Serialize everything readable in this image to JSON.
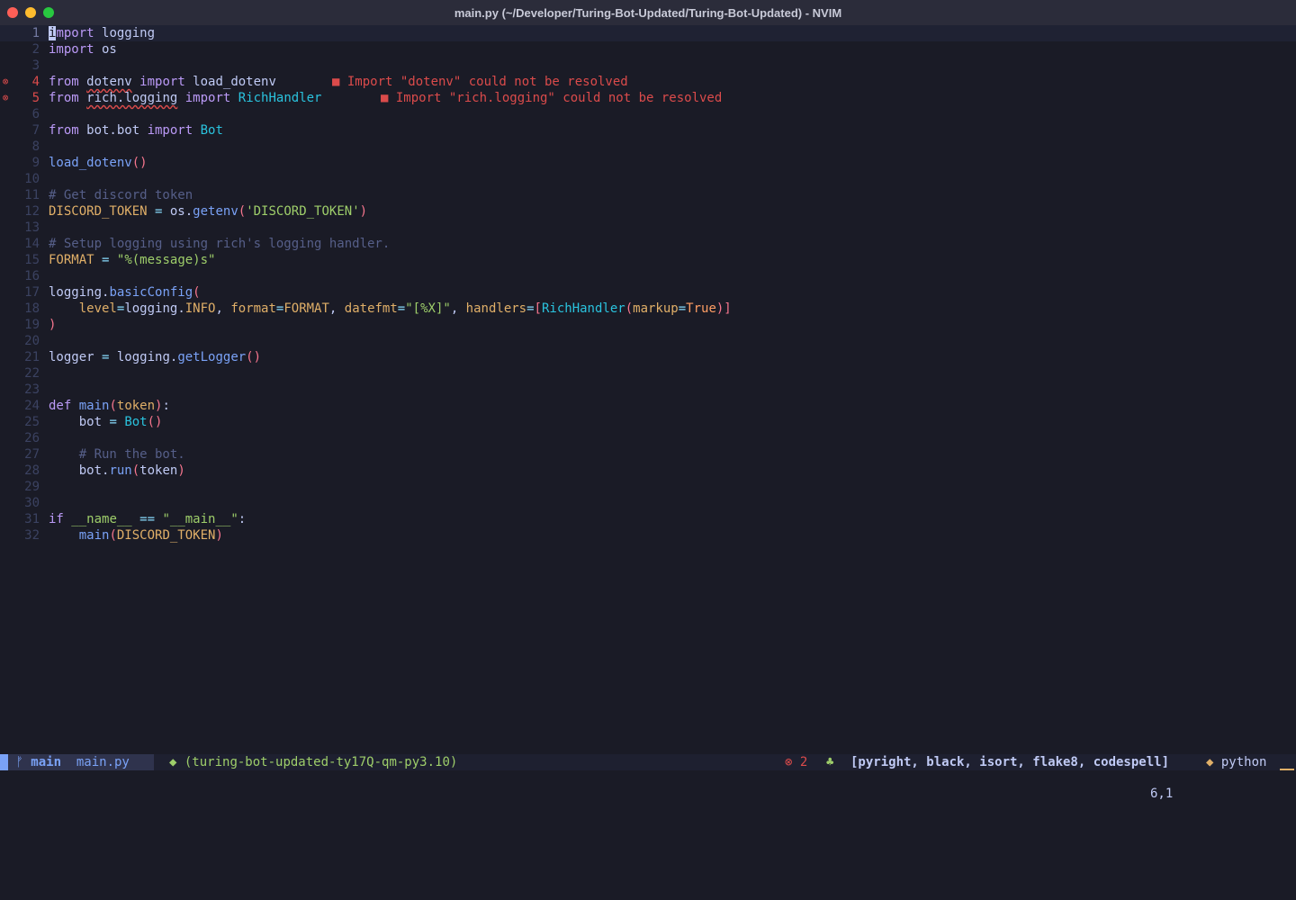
{
  "window": {
    "title": "main.py (~/Developer/Turing-Bot-Updated/Turing-Bot-Updated) - NVIM"
  },
  "diagnostics": {
    "line4": "■ Import \"dotenv\" could not be resolved",
    "line5": "■ Import \"rich.logging\" could not be resolved",
    "sign": "⊗"
  },
  "statusline": {
    "branch_icon": "ᚠ",
    "branch": "main",
    "file": "main.py",
    "env_icon": "◆",
    "env": "(turing-bot-updated-ty17Q-qm-py3.10)",
    "error_icon": "⊗",
    "error_count": "2",
    "lsp_icon": "♣",
    "lsp": "[pyright, black, isort, flake8, codespell]",
    "filetype_icon": "◆",
    "filetype": "python"
  },
  "cmdline": {
    "ruler": "6,1"
  },
  "colors": {
    "background": "#1a1b26",
    "accent": "#7aa2f7",
    "error": "#db4b4b",
    "string": "#9ece6a",
    "keyword": "#bb9af7"
  }
}
